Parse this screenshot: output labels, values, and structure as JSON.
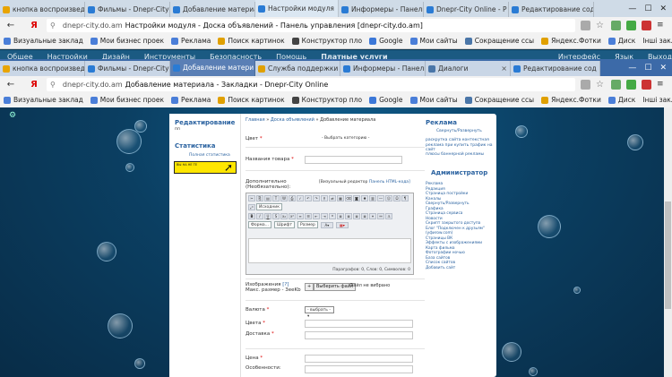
{
  "browser1": {
    "tabs": [
      {
        "label": "кнопка воспроизвед",
        "color": "#e8a400",
        "state": "normal"
      },
      {
        "label": "Фильмы - Dnepr-City",
        "color": "#2a7bd4",
        "state": "normal"
      },
      {
        "label": "Добавление материа",
        "color": "#2a7bd4",
        "state": "normal"
      },
      {
        "label": "Настройки модуля",
        "color": "#2a7bd4",
        "state": "active"
      },
      {
        "label": "Информеры - Панель",
        "color": "#2a7bd4",
        "state": "normal"
      },
      {
        "label": "Dnepr-City Online - Р",
        "color": "#2a7bd4",
        "state": "normal"
      },
      {
        "label": "Редактирование содер",
        "color": "#2a7bd4",
        "state": "normal"
      }
    ],
    "window_buttons": [
      "—",
      "☐",
      "✕"
    ],
    "host": "dnepr-city.do.am",
    "title": "Настройки модуля - Доска объявлений - Панель управления [dnepr-city.do.am]",
    "bookmarks": [
      {
        "label": "Визуальные заклад",
        "color": "#4a7ed8"
      },
      {
        "label": "Мои бизнес проек",
        "color": "#4a7ed8"
      },
      {
        "label": "Реклама",
        "color": "#4a7ed8"
      },
      {
        "label": "Поиск картинок",
        "color": "#e0a000"
      },
      {
        "label": "Конструктор пло",
        "color": "#444"
      },
      {
        "label": "Google",
        "color": "#3c78d8"
      },
      {
        "label": "Мои сайты",
        "color": "#4a7ed8"
      },
      {
        "label": "Сокращение ссы",
        "color": "#4a76a8"
      },
      {
        "label": "Яндекс.Фотки",
        "color": "#e0a000"
      },
      {
        "label": "Диск",
        "color": "#4a7ed8"
      }
    ],
    "other_bookmarks": "Інші закладки"
  },
  "site_strip": [
    "Общее",
    "Настройки",
    "Дизайн",
    "Инструменты",
    "Безопасность",
    "Помощь",
    "Платные услуги",
    "",
    "Интерфейс",
    "Язык",
    "Выход"
  ],
  "browser2": {
    "tabs": [
      {
        "label": "кнопка воспроизвед",
        "color": "#e8a400",
        "state": "normal"
      },
      {
        "label": "Фильмы - Dnepr-City",
        "color": "#2a7bd4",
        "state": "normal"
      },
      {
        "label": "Добавление матери",
        "color": "#2a7bd4",
        "state": "active"
      },
      {
        "label": "Служба поддержки",
        "color": "#e0a000",
        "state": "normal"
      },
      {
        "label": "Информеры - Панель",
        "color": "#2a7bd4",
        "state": "normal"
      },
      {
        "label": "Диалоги",
        "color": "#4a76a8",
        "state": "normal"
      },
      {
        "label": "Редактирование сод",
        "color": "#2a7bd4",
        "state": "normal"
      }
    ],
    "host": "dnepr-city.do.am",
    "title": "Добавление материала - Закладки - Dnepr-City Online",
    "bookmarks": [
      {
        "label": "Визуальные заклад",
        "color": "#4a7ed8"
      },
      {
        "label": "Мои бизнес проек",
        "color": "#4a7ed8"
      },
      {
        "label": "Реклама",
        "color": "#4a7ed8"
      },
      {
        "label": "Поиск картинок",
        "color": "#e0a000"
      },
      {
        "label": "Конструктор пло",
        "color": "#444"
      },
      {
        "label": "Google",
        "color": "#3c78d8"
      },
      {
        "label": "Мои сайты",
        "color": "#4a7ed8"
      },
      {
        "label": "Сокращение ссы",
        "color": "#4a76a8"
      },
      {
        "label": "Яндекс.Фотки",
        "color": "#e0a000"
      },
      {
        "label": "Диск",
        "color": "#4a7ed8"
      }
    ],
    "other_bookmarks": "Інші закладки"
  },
  "page": {
    "left": {
      "edit_heading": "Редактирование",
      "edit_sub": "пп",
      "stats_heading": "Статистика",
      "stats_link": "Полная статистика",
      "speed_text": "ВЫ НА НЕ ТЕ"
    },
    "crumb": {
      "home": "Главная",
      "sep": "»",
      "section": "Доска объявлений",
      "current": "Добавление материала"
    },
    "form": {
      "color_label": "Цвет",
      "color_select": "- Выбрать категорию -",
      "name_label": "Названия товара",
      "extra_label": "Дополнительно (Необязательно):",
      "visual_editor": "[Визуальный редактор",
      "html_mode": "Панель HTML-кода]",
      "stamp_btn": "Исходник",
      "format_combo": "Форма...",
      "font_combo": "Шрифт",
      "size_combo": "Размер",
      "status": "Параграфов: 0, Слов: 0, Символов: 0",
      "images_label": "Изображения",
      "images_help": "[?]",
      "images_max": "Макс. размер - 3eeKb",
      "add_btn": "+",
      "choose_file": "Выберить файл",
      "no_file": "Файл не вибрано",
      "currency_label": "Валюта",
      "currency_value": "- выбрать -",
      "price_color_label": "Цвета",
      "delivery_label": "Доставка",
      "price_label": "Цена",
      "features_label": "Особенности:"
    },
    "right": {
      "ads_heading": "Реклама",
      "ads_toggle": "Свернуть/Развернуть",
      "ads_lines": [
        "раскрутка сайта контекстная",
        "реклама при купить трафик на сайт",
        "плюсы баннерной рекламы"
      ],
      "admin_heading": "Администратор",
      "admin_links": [
        "Реклама",
        "Редакция",
        "Страница постройки",
        "Каналы",
        "Свернуть/Развернуть",
        "Графика",
        "Страница сервиса",
        "Новости",
        "Скрипт закрытого доступа",
        "Блог \"Подключен к друзьям\"",
        "(уфиrow.com)",
        "Страницы ВК",
        "Эффекты с изображениями",
        "Карта фильма",
        "Фотографии ночью",
        "База сайтов",
        "Список сайтов",
        "Добавить сайт"
      ]
    }
  }
}
